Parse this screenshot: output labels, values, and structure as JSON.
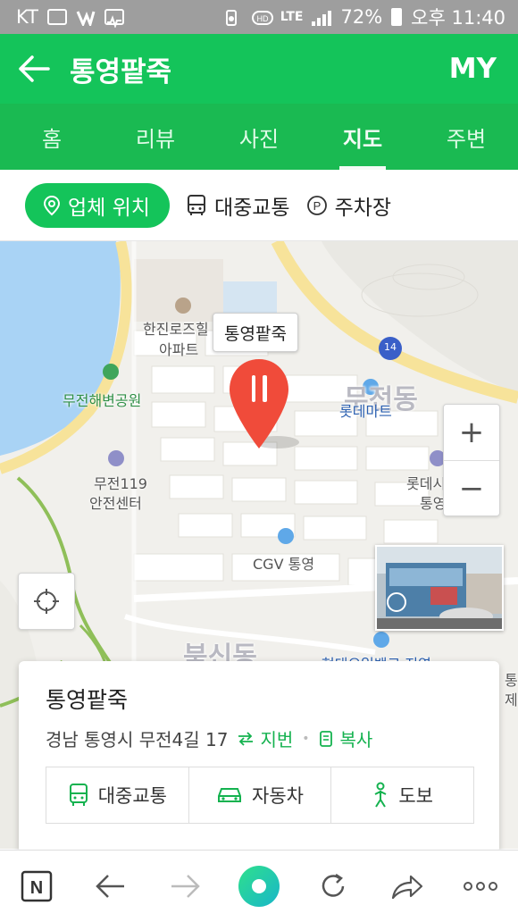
{
  "status": {
    "carrier": "KT",
    "network": "LTE",
    "battery": "72%",
    "time": "오후 11:40"
  },
  "header": {
    "title": "통영팥죽",
    "my_label": "MY"
  },
  "tabs": [
    {
      "label": "홈"
    },
    {
      "label": "리뷰"
    },
    {
      "label": "사진"
    },
    {
      "label": "지도"
    },
    {
      "label": "주변"
    }
  ],
  "filters": {
    "location": "업체 위치",
    "transit": "대중교통",
    "parking": "주차장"
  },
  "map": {
    "callout": "통영팥죽",
    "labels": {
      "apt1": "한진로즈힐",
      "apt2": "아파트",
      "park": "무전해변공원",
      "mart": "롯데마트",
      "dong1": "무전동",
      "fire1": "무전119",
      "fire2": "안전센터",
      "cinema": "CGV 통영",
      "lotte1": "롯데시네마",
      "lotte2": "통영점",
      "dong2": "북신동",
      "bank": "현대오일뱅크 지역",
      "edge1": "통",
      "edge2": "제",
      "road": "14"
    },
    "zoom_in": "+",
    "zoom_out": "−"
  },
  "card": {
    "name": "통영팥죽",
    "address": "경남 통영시 무전4길 17",
    "lot_label": "지번",
    "copy_label": "복사",
    "routes": [
      "대중교통",
      "자동차",
      "도보"
    ]
  },
  "colors": {
    "brand_green": "#14c45a"
  }
}
